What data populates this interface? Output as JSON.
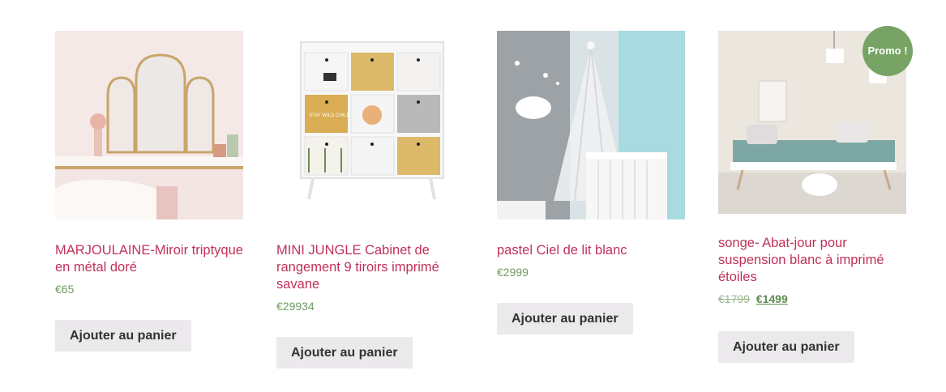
{
  "products": [
    {
      "title": "MARJOULAINE-Miroir triptyque en métal doré",
      "price": "€65",
      "button": "Ajouter au panier"
    },
    {
      "title": "MINI JUNGLE Cabinet de rangement 9 tiroirs imprimé savane",
      "price": "€29934",
      "button": "Ajouter au panier"
    },
    {
      "title": "pastel Ciel de lit blanc",
      "price": "€2999",
      "button": "Ajouter au panier"
    },
    {
      "title": "songe- Abat-jour pour suspension blanc à imprimé étoiles",
      "old_price": "€1799",
      "price": "€1499",
      "button": "Ajouter au panier",
      "badge": "Promo !"
    }
  ],
  "cabinet_print": "STAY WILD CHILD",
  "colors": {
    "title": "#c0305a",
    "price": "#6f9a63",
    "button_bg": "#ebe9eb",
    "promo_badge": "#77a464"
  }
}
